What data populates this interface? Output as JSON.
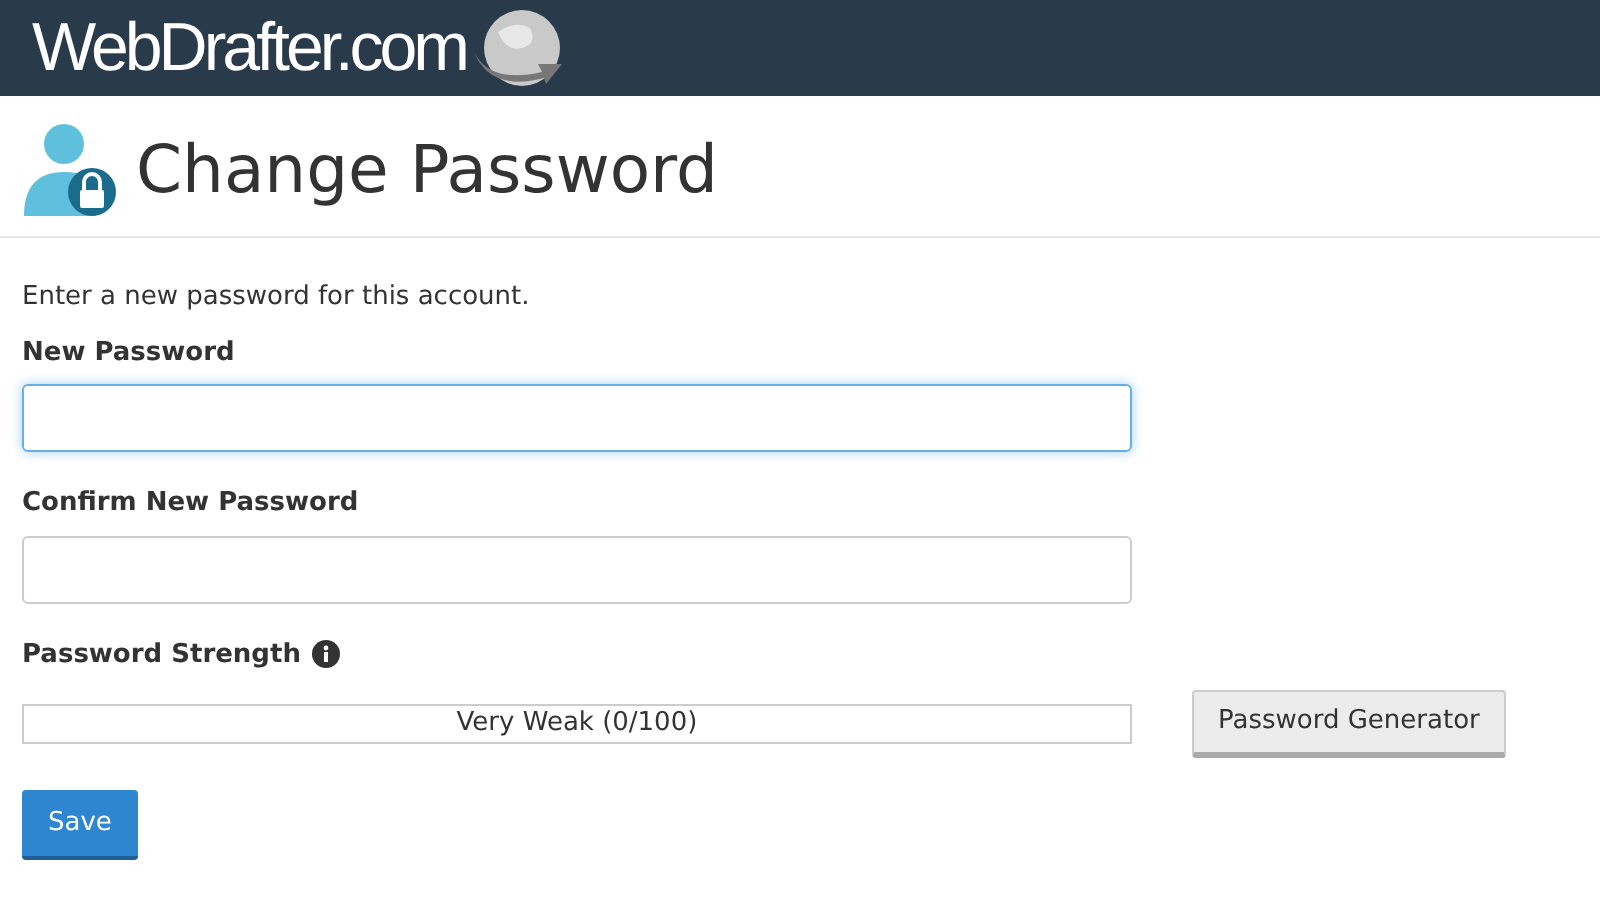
{
  "header": {
    "logo": "WebDrafter.com"
  },
  "page": {
    "title": "Change Password"
  },
  "intro": "Enter a new password for this account.",
  "fields": [
    {
      "label": "New Password",
      "focused": true
    },
    {
      "label": "Confirm New Password",
      "focused": false
    }
  ],
  "strength": {
    "label": "Password Strength",
    "level": 0,
    "reading": "Very Weak (0/100)"
  },
  "buttons": {
    "generator": "Password Generator",
    "save": "Save"
  }
}
